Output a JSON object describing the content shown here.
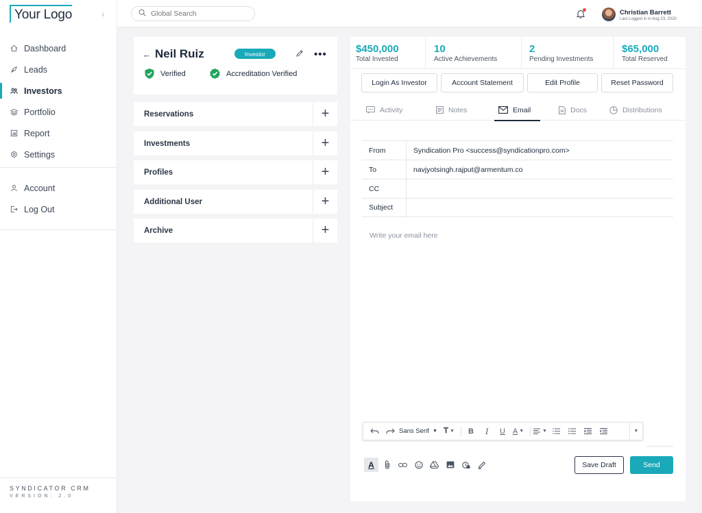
{
  "app": {
    "logo": "Your Logo",
    "brand": "SYNDICATOR CRM",
    "version": "VERSION: 2.0"
  },
  "sidebar": {
    "items": [
      {
        "label": "Dashboard",
        "icon": "home-icon"
      },
      {
        "label": "Leads",
        "icon": "leads-icon"
      },
      {
        "label": "Investors",
        "icon": "investors-icon",
        "active": true
      },
      {
        "label": "Portfolio",
        "icon": "portfolio-icon"
      },
      {
        "label": "Report",
        "icon": "report-icon"
      },
      {
        "label": "Settings",
        "icon": "settings-icon"
      }
    ],
    "bottom_items": [
      {
        "label": "Account",
        "icon": "account-icon"
      },
      {
        "label": "Log Out",
        "icon": "logout-icon"
      }
    ]
  },
  "topbar": {
    "search_placeholder": "Global Search",
    "user_name": "Christian Barrett",
    "user_sub": "Last Logged in in Aug 23, 2020"
  },
  "profile": {
    "name": "Neil Ruiz",
    "badge": "Investor",
    "verified": "Verified",
    "accreditation": "Accreditation Verified"
  },
  "accordion": [
    "Reservations",
    "Investments",
    "Profiles",
    "Additional User",
    "Archive"
  ],
  "stats": [
    {
      "value": "$450,000",
      "label": "Total Invested"
    },
    {
      "value": "10",
      "label": "Active Achievements"
    },
    {
      "value": "2",
      "label": "Pending Investments"
    },
    {
      "value": "$65,000",
      "label": "Total Reserved"
    }
  ],
  "actions": [
    "Login As Investor",
    "Account Statement",
    "Edit Profile",
    "Reset Password"
  ],
  "tabs": [
    {
      "label": "Activity",
      "icon": "activity-icon"
    },
    {
      "label": "Notes",
      "icon": "notes-icon"
    },
    {
      "label": "Email",
      "icon": "email-icon",
      "active": true
    },
    {
      "label": "Docs",
      "icon": "docs-icon"
    },
    {
      "label": "Distributions",
      "icon": "distributions-icon"
    }
  ],
  "email": {
    "from_label": "From",
    "from_value": "Syndication Pro <success@syndicationpro.com>",
    "to_label": "To",
    "to_value": "navjyotsingh.rajput@armentum.co",
    "cc_label": "CC",
    "cc_value": "",
    "subject_label": "Subject",
    "subject_value": "",
    "body_placeholder": "Write your email here",
    "font": "Sans Serif",
    "save_draft": "Save Draft",
    "send": "Send"
  },
  "colors": {
    "accent": "#1aa9b9",
    "verified": "#22a45d",
    "notification": "#e74c3c"
  }
}
